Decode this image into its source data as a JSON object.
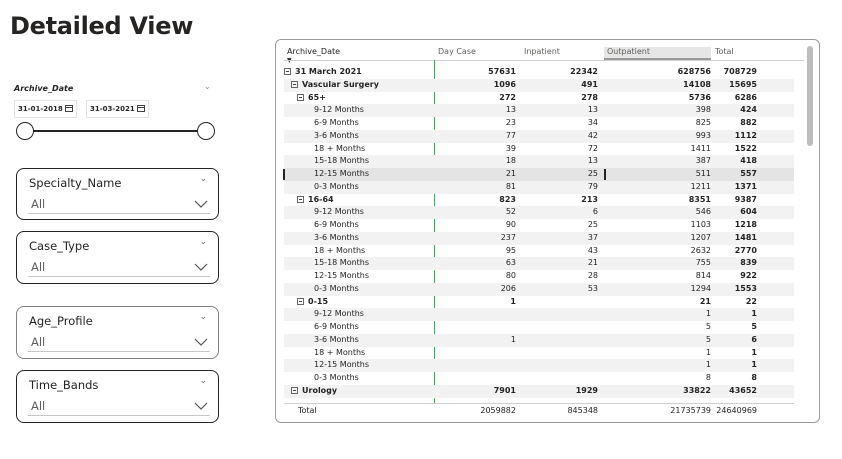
{
  "page_title": "Detailed View",
  "date_slicer": {
    "title": "Archive_Date",
    "start": "31-01-2018",
    "end": "31-03-2021",
    "start_fraction": 0,
    "end_fraction": 1
  },
  "slicers": [
    {
      "title": "Specialty_Name",
      "value": "All"
    },
    {
      "title": "Case_Type",
      "value": "All"
    },
    {
      "title": "Age_Profile",
      "value": "All"
    },
    {
      "title": "Time_Bands",
      "value": "All"
    }
  ],
  "matrix": {
    "headers": {
      "row_label": "Archive_Date",
      "col1": "Day Case",
      "col2": "Inpatient",
      "col3": "Outpatient",
      "col4": "Total"
    },
    "rows": [
      {
        "label": "31 March 2021",
        "level": 0,
        "expand": true,
        "bold": true,
        "c1": "57631",
        "c2": "22342",
        "c3": "628756",
        "c4": "708729"
      },
      {
        "label": "Vascular Surgery",
        "level": 1,
        "expand": true,
        "bold": true,
        "c1": "1096",
        "c2": "491",
        "c3": "14108",
        "c4": "15695"
      },
      {
        "label": "65+",
        "level": 2,
        "expand": true,
        "bold": true,
        "c1": "272",
        "c2": "278",
        "c3": "5736",
        "c4": "6286"
      },
      {
        "label": "9-12 Months",
        "level": 3,
        "c1": "13",
        "c2": "13",
        "c3": "398",
        "c4": "424"
      },
      {
        "label": "6-9 Months",
        "level": 3,
        "c1": "23",
        "c2": "34",
        "c3": "825",
        "c4": "882"
      },
      {
        "label": "3-6 Months",
        "level": 3,
        "c1": "77",
        "c2": "42",
        "c3": "993",
        "c4": "1112"
      },
      {
        "label": "18 + Months",
        "level": 3,
        "c1": "39",
        "c2": "72",
        "c3": "1411",
        "c4": "1522"
      },
      {
        "label": "15-18 Months",
        "level": 3,
        "c1": "18",
        "c2": "13",
        "c3": "387",
        "c4": "418"
      },
      {
        "label": "12-15 Months",
        "level": 3,
        "c1": "21",
        "c2": "25",
        "c3": "511",
        "c4": "557",
        "highlight": true
      },
      {
        "label": "0-3 Months",
        "level": 3,
        "c1": "81",
        "c2": "79",
        "c3": "1211",
        "c4": "1371"
      },
      {
        "label": "16-64",
        "level": 2,
        "expand": true,
        "bold": true,
        "c1": "823",
        "c2": "213",
        "c3": "8351",
        "c4": "9387"
      },
      {
        "label": "9-12 Months",
        "level": 3,
        "c1": "52",
        "c2": "6",
        "c3": "546",
        "c4": "604"
      },
      {
        "label": "6-9 Months",
        "level": 3,
        "c1": "90",
        "c2": "25",
        "c3": "1103",
        "c4": "1218"
      },
      {
        "label": "3-6 Months",
        "level": 3,
        "c1": "237",
        "c2": "37",
        "c3": "1207",
        "c4": "1481"
      },
      {
        "label": "18 + Months",
        "level": 3,
        "c1": "95",
        "c2": "43",
        "c3": "2632",
        "c4": "2770"
      },
      {
        "label": "15-18 Months",
        "level": 3,
        "c1": "63",
        "c2": "21",
        "c3": "755",
        "c4": "839"
      },
      {
        "label": "12-15 Months",
        "level": 3,
        "c1": "80",
        "c2": "28",
        "c3": "814",
        "c4": "922"
      },
      {
        "label": "0-3 Months",
        "level": 3,
        "c1": "206",
        "c2": "53",
        "c3": "1294",
        "c4": "1553"
      },
      {
        "label": "0-15",
        "level": 2,
        "expand": true,
        "bold": true,
        "c1": "1",
        "c2": "",
        "c3": "21",
        "c4": "22"
      },
      {
        "label": "9-12 Months",
        "level": 3,
        "c1": "",
        "c2": "",
        "c3": "1",
        "c4": "1"
      },
      {
        "label": "6-9 Months",
        "level": 3,
        "c1": "",
        "c2": "",
        "c3": "5",
        "c4": "5"
      },
      {
        "label": "3-6 Months",
        "level": 3,
        "c1": "1",
        "c2": "",
        "c3": "5",
        "c4": "6"
      },
      {
        "label": "18 + Months",
        "level": 3,
        "c1": "",
        "c2": "",
        "c3": "1",
        "c4": "1"
      },
      {
        "label": "12-15 Months",
        "level": 3,
        "c1": "",
        "c2": "",
        "c3": "1",
        "c4": "1"
      },
      {
        "label": "0-3 Months",
        "level": 3,
        "c1": "",
        "c2": "",
        "c3": "8",
        "c4": "8"
      },
      {
        "label": "Urology",
        "level": 1,
        "expand": true,
        "bold": true,
        "c1": "7901",
        "c2": "1929",
        "c3": "33822",
        "c4": "43652"
      }
    ],
    "total": {
      "label": "Total",
      "c1": "2059882",
      "c2": "845348",
      "c3": "21735739",
      "c4": "24640969"
    }
  }
}
